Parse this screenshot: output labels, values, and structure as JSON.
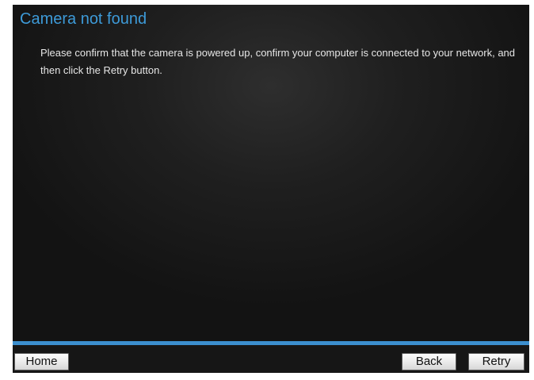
{
  "dialog": {
    "title": "Camera not found",
    "message": "Please confirm that the camera is powered up, confirm your computer is connected to your network, and then click the Retry button."
  },
  "footer": {
    "home_label": "Home",
    "back_label": "Back",
    "retry_label": "Retry"
  },
  "colors": {
    "title": "#3d9ad8",
    "accent_bar": "#3c8fce",
    "background": "#1f1f1f"
  }
}
